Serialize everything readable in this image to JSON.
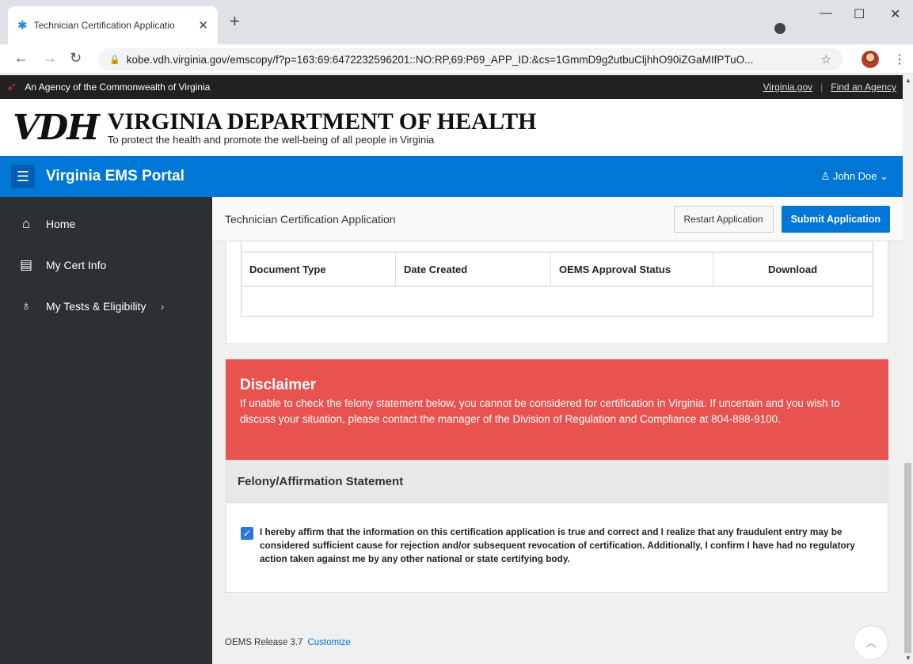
{
  "browser": {
    "tab_title": "Technician Certification Applicatio",
    "url": "kobe.vdh.virginia.gov/emscopy/f?p=163:69:6472232596201::NO:RP,69:P69_APP_ID:&cs=1GmmD9g2utbuCljhhO90iZGaMIfPTuO..."
  },
  "agency_bar": {
    "text": "An Agency of the Commonwealth of Virginia",
    "link1": "Virginia.gov",
    "link2": "Find an Agency"
  },
  "banner": {
    "logo": "VDH",
    "name": "VIRGINIA DEPARTMENT OF HEALTH",
    "tagline": "To protect the health and promote the well-being of all people in Virginia"
  },
  "header": {
    "title": "Virginia EMS Portal",
    "user": "John Doe"
  },
  "sidebar": {
    "items": [
      {
        "label": "Home"
      },
      {
        "label": "My Cert Info"
      },
      {
        "label": "My Tests & Eligibility"
      }
    ]
  },
  "page": {
    "title": "Technician Certification Application",
    "restart_label": "Restart Application",
    "submit_label": "Submit Application"
  },
  "documents": {
    "columns": [
      "Document Type",
      "Date Created",
      "OEMS Approval Status",
      "Download"
    ]
  },
  "disclaimer": {
    "heading": "Disclaimer",
    "text": "If unable to check the felony statement below, you cannot be considered for certification in Virginia. If uncertain and you wish to discuss your situation, please contact the manager of the Division of Regulation and Compliance at 804-888-9100."
  },
  "felony": {
    "heading": "Felony/Affirmation Statement",
    "statement": "I hereby affirm that the information on this certification application is true and correct and I realize that any fraudulent entry may be considered sufficient cause for rejection and/or subsequent revocation of certification. Additionally, I confirm I have had no regulatory action taken against me by any other national or state certifying body.",
    "checked": true
  },
  "footer": {
    "release": "OEMS Release 3.7",
    "customize": "Customize"
  },
  "colors": {
    "primary": "#0076d6",
    "disclaimer": "#e9534f",
    "sidebar": "#2b3035"
  }
}
